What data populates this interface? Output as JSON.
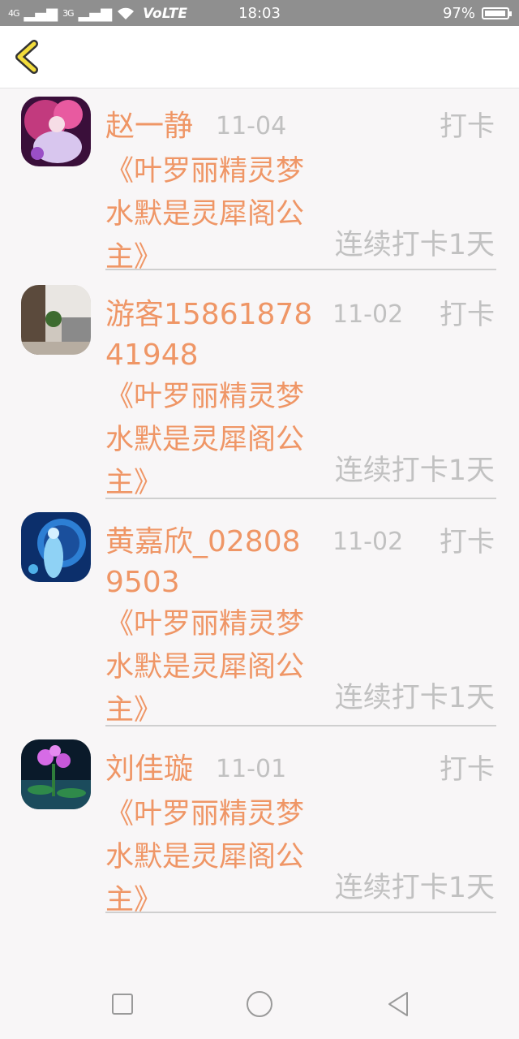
{
  "status_bar": {
    "signal1": "4G",
    "signal2": "3G",
    "network": "VoLTE",
    "time": "18:03",
    "battery": "97%",
    "battery_level": 0.97
  },
  "header": {
    "back_icon": "chevron-left-icon",
    "accent_color": "#f2dc3c"
  },
  "entries": [
    {
      "name": "赵一静",
      "date": "11-04",
      "action": "打卡",
      "book": "《叶罗丽精灵梦水默是灵犀阁公主》",
      "streak": "连续打卡1天"
    },
    {
      "name": "游客1586187841948",
      "date": "11-02",
      "action": "打卡",
      "book": "《叶罗丽精灵梦水默是灵犀阁公主》",
      "streak": "连续打卡1天"
    },
    {
      "name": "黄嘉欣_028089503",
      "date": "11-02",
      "action": "打卡",
      "book": "《叶罗丽精灵梦水默是灵犀阁公主》",
      "streak": "连续打卡1天"
    },
    {
      "name": "刘佳璇",
      "date": "11-01",
      "action": "打卡",
      "book": "《叶罗丽精灵梦水默是灵犀阁公主》",
      "streak": "连续打卡1天"
    }
  ],
  "colors": {
    "name": "#ef9666",
    "muted": "#c1c1c1",
    "background": "#f8f6f7"
  },
  "nav_bar": {
    "recent_icon": "square-icon",
    "home_icon": "circle-icon",
    "back_icon": "triangle-back-icon"
  }
}
